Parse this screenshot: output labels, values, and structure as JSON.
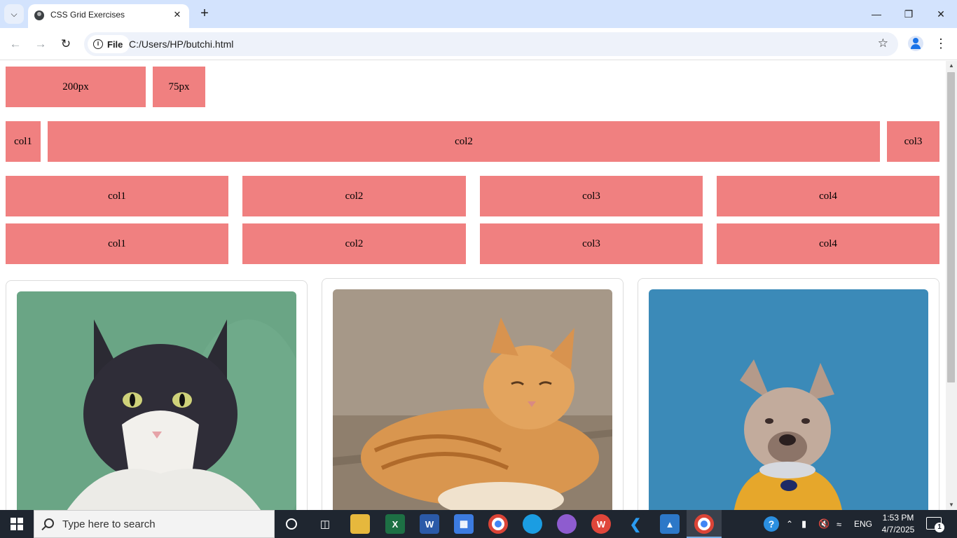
{
  "browser": {
    "tab_title": "CSS Grid Exercises",
    "site_chip": "File",
    "url": "C:/Users/HP/butchi.html"
  },
  "page": {
    "row1": [
      "200px",
      "75px"
    ],
    "row2": [
      "col1",
      "col2",
      "col3"
    ],
    "row3": [
      "col1",
      "col2",
      "col3",
      "col4"
    ],
    "row4": [
      "col1",
      "col2",
      "col3",
      "col4"
    ],
    "box_color": "#f08080",
    "cards": [
      {
        "photo": "cat-black-white-on-green"
      },
      {
        "photo": "orange-tabby-cat-sleeping"
      },
      {
        "photo": "french-bulldog-in-yellow-shirt-on-blue"
      }
    ]
  },
  "taskbar": {
    "search_placeholder": "Type here to search",
    "language": "ENG",
    "time": "1:53 PM",
    "date": "4/7/2025",
    "notification_count": "1"
  }
}
